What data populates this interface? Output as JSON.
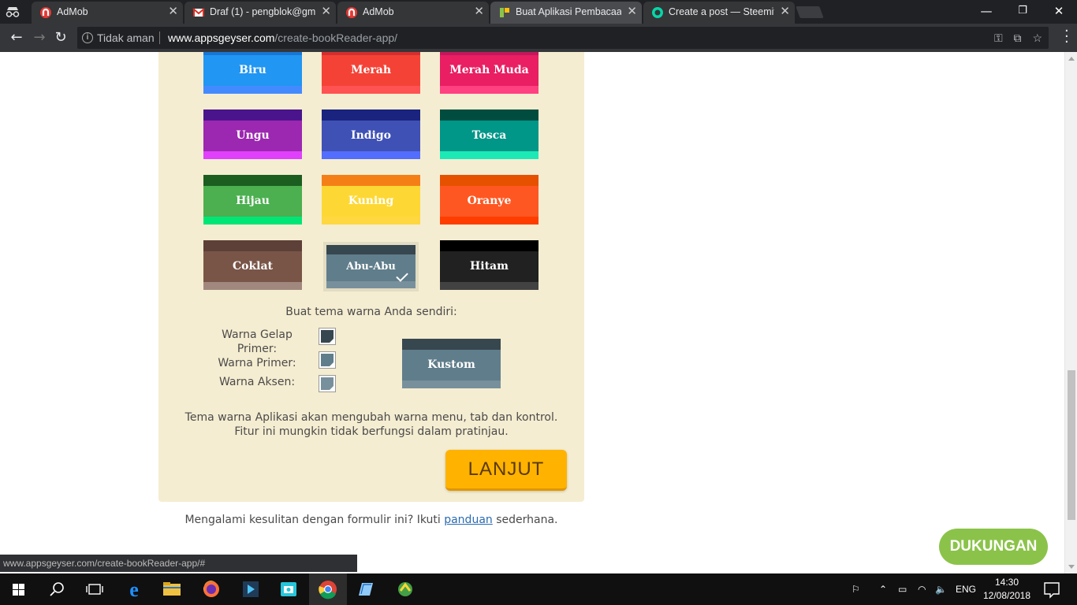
{
  "browser": {
    "tabs": [
      {
        "title": "AdMob",
        "favicon": "admob-icon",
        "active": false
      },
      {
        "title": "Draf (1) - pengblok@gm…",
        "favicon": "gmail-icon",
        "active": false
      },
      {
        "title": "AdMob",
        "favicon": "admob-icon",
        "active": false
      },
      {
        "title": "Buat Aplikasi Pembacaan",
        "favicon": "appsgeyser-icon",
        "active": true
      },
      {
        "title": "Create a post — Steemit",
        "favicon": "steemit-icon",
        "active": false
      }
    ],
    "security_text": "Tidak aman",
    "url_domain": "www.appsgeyser.com",
    "url_path": "/create-bookReader-app/",
    "status_url": "www.appsgeyser.com/create-bookReader-app/#"
  },
  "themes": [
    {
      "label": "Biru",
      "dark": "#1976d2",
      "primary": "#2196f3",
      "accent": "#448aff",
      "selected": false
    },
    {
      "label": "Merah",
      "dark": "#d32f2f",
      "primary": "#f44336",
      "accent": "#ff5252",
      "selected": false
    },
    {
      "label": "Merah Muda",
      "dark": "#c2185b",
      "primary": "#e91e63",
      "accent": "#ff4081",
      "selected": false
    },
    {
      "label": "Ungu",
      "dark": "#4a148c",
      "primary": "#9c27b0",
      "accent": "#e040fb",
      "selected": false
    },
    {
      "label": "Indigo",
      "dark": "#1a237e",
      "primary": "#3f51b5",
      "accent": "#536dfe",
      "selected": false
    },
    {
      "label": "Tosca",
      "dark": "#004d40",
      "primary": "#009688",
      "accent": "#1de9b6",
      "selected": false
    },
    {
      "label": "Hijau",
      "dark": "#1b5e20",
      "primary": "#4caf50",
      "accent": "#00e676",
      "selected": false
    },
    {
      "label": "Kuning",
      "dark": "#f57f17",
      "primary": "#fdd835",
      "accent": "#ffd740",
      "selected": false
    },
    {
      "label": "Oranye",
      "dark": "#e65100",
      "primary": "#ff5722",
      "accent": "#ff3d00",
      "selected": false
    },
    {
      "label": "Coklat",
      "dark": "#5d4037",
      "primary": "#795548",
      "accent": "#a1887f",
      "selected": false
    },
    {
      "label": "Abu-Abu",
      "dark": "#37474f",
      "primary": "#607d8b",
      "accent": "#78909c",
      "selected": true
    },
    {
      "label": "Hitam",
      "dark": "#000000",
      "primary": "#212121",
      "accent": "#424242",
      "selected": false
    }
  ],
  "custom": {
    "heading": "Buat tema warna Anda sendiri:",
    "dark_primary_label": "Warna Gelap Primer:",
    "primary_label": "Warna Primer:",
    "accent_label": "Warna Aksen:",
    "dark_primary_color": "#37474f",
    "primary_color": "#607d8b",
    "accent_color": "#78909c",
    "preview_label": "Kustom"
  },
  "note_line1": "Tema warna Aplikasi akan mengubah warna menu, tab dan kontrol.",
  "note_line2": "Fitur ini mungkin tidak berfungsi dalam pratinjau.",
  "next_button": "LANJUT",
  "help": {
    "before": "Mengalami kesulitan dengan formulir ini? Ikuti ",
    "link": "panduan",
    "after": " sederhana."
  },
  "support_button": "DUKUNGAN",
  "taskbar": {
    "language": "ENG",
    "time": "14:30",
    "date": "12/08/2018"
  }
}
